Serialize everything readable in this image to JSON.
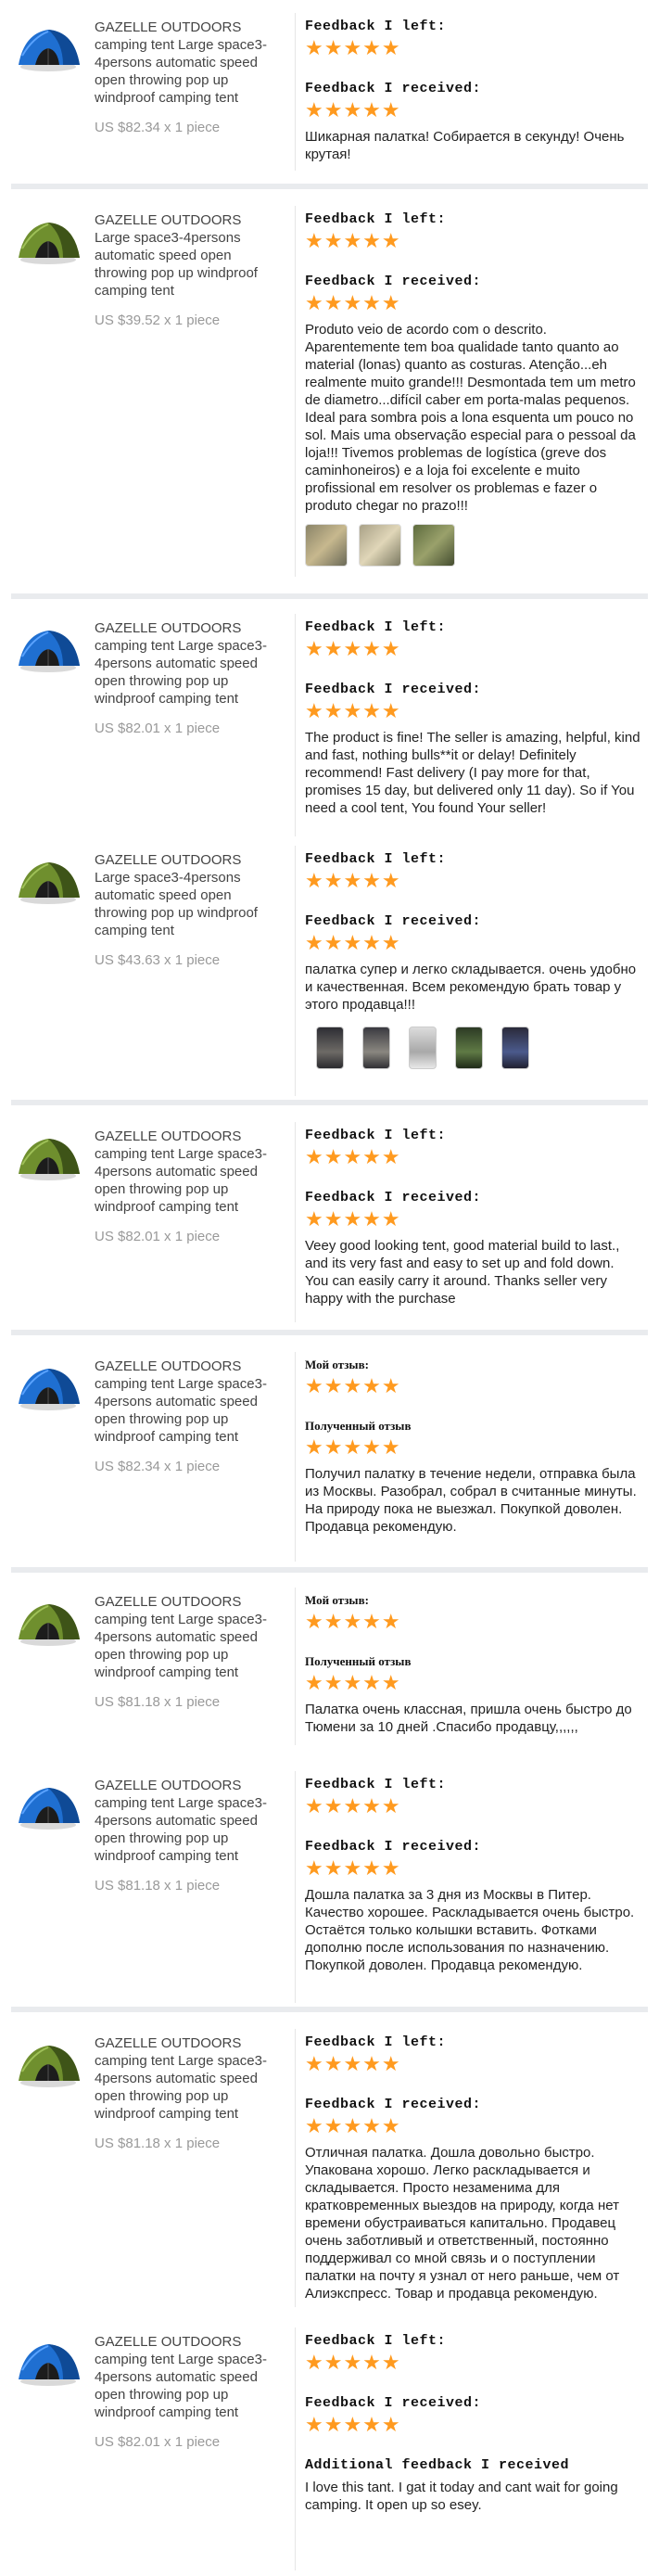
{
  "colors": {
    "star": "#ff9a1f",
    "divider": "#e9ebee",
    "price": "#999999"
  },
  "star_glyphs": "★★★★★",
  "reviews": [
    {
      "tent_color": "blue",
      "brand": "GAZELLE OUTDOORS",
      "name": "camping tent Large space3-4persons automatic speed open throwing pop up windproof camping tent",
      "price": "US $82.34 x 1 piece",
      "left_label": "Feedback I left:",
      "received_label": "Feedback I received:",
      "text": "Шикарная палатка! Собирается в секунду! Очень крутая!"
    },
    {
      "tent_color": "green",
      "brand": "GAZELLE OUTDOORS",
      "name": "Large space3-4persons automatic speed open throwing pop up windproof camping tent",
      "price": "US $39.52 x 1 piece",
      "left_label": "Feedback I left:",
      "received_label": "Feedback I received:",
      "text": "Produto veio de acordo com o descrito. Aparentemente tem boa qualidade tanto quanto ao material (lonas) quanto as costuras. Atenção...eh realmente muito grande!!! Desmontada tem um metro de diametro...difícil caber em porta-malas pequenos. Ideal para sombra pois a lona esquenta um pouco no sol. Mais uma observação especial para o pessoal da loja!!! Tivemos problemas de logística (greve dos caminhoneiros) e a loja foi excelente e muito profissional em resolver os problemas e fazer o produto chegar no prazo!!!",
      "photos": 3
    },
    {
      "tent_color": "blue",
      "brand": "GAZELLE OUTDOORS",
      "name": "camping tent Large space3-4persons automatic speed open throwing pop up windproof camping tent",
      "price": "US $82.01 x 1 piece",
      "left_label": "Feedback I left:",
      "received_label": "Feedback I received:",
      "text": "The product is fine! The seller is amazing, helpful, kind and fast, nothing bulls**it or delay! Definitely recommend! Fast delivery (I pay more for that, promises 15 day, but delivered only 11 day). So if You need a cool tent, You found Your seller!"
    },
    {
      "tent_color": "green",
      "brand": "GAZELLE OUTDOORS",
      "name": "Large space3-4persons automatic speed open throwing pop up windproof camping tent",
      "price": "US $43.63 x 1 piece",
      "left_label": "Feedback I left:",
      "received_label": "Feedback I received:",
      "text": "палатка супер и легко складывается. очень удобно и качественная. Всем рекомендую брать товар у этого продавца!!!",
      "photos": 5
    },
    {
      "tent_color": "green",
      "brand": "GAZELLE OUTDOORS",
      "name": "camping tent Large space3-4persons automatic speed open throwing pop up windproof camping tent",
      "price": "US $82.01 x 1 piece",
      "left_label": "Feedback I left:",
      "received_label": "Feedback I received:",
      "text": "Veey good looking tent, good material build to last., and its very fast and easy to set up and fold down. You can easily carry it around. Thanks seller very happy with the purchase"
    },
    {
      "tent_color": "blue",
      "brand": "GAZELLE OUTDOORS",
      "name": "camping tent Large space3-4persons automatic speed open throwing pop up windproof camping tent",
      "price": "US $82.34 x 1 piece",
      "left_label": "Мой отзыв:",
      "received_label": "Полученный отзыв",
      "ru_labels": true,
      "text": "Получил палатку в течение недели, отправка была из Москвы. Разобрал, собрал в считанные минуты. На природу пока не выезжал. Покупкой доволен. Продавца рекомендую."
    },
    {
      "tent_color": "green",
      "brand": "GAZELLE OUTDOORS",
      "name": "camping tent Large space3-4persons automatic speed open throwing pop up windproof camping tent",
      "price": "US $81.18 x 1 piece",
      "left_label": "Мой отзыв:",
      "received_label": "Полученный отзыв",
      "ru_labels": true,
      "text": "Палатка очень классная, пришла очень быстро до Тюмени за 10 дней .Спасибо продавцу,,,,,,"
    },
    {
      "tent_color": "blue",
      "brand": "GAZELLE OUTDOORS",
      "name": "camping tent Large space3-4persons automatic speed open throwing pop up windproof camping tent",
      "price": "US $81.18 x 1 piece",
      "left_label": "Feedback I left:",
      "received_label": "Feedback I received:",
      "text": "Дошла палатка за 3 дня из Москвы в Питер. Качество хорошее. Раскладывается очень быстро. Остаётся только колышки вставить. Фотками дополню после использования по назначению. Покупкой доволен. Продавца рекомендую."
    },
    {
      "tent_color": "green",
      "brand": "GAZELLE OUTDOORS",
      "name": "camping tent Large space3-4persons automatic speed open throwing pop up windproof camping tent",
      "price": "US $81.18 x 1 piece",
      "left_label": "Feedback I left:",
      "received_label": "Feedback I received:",
      "text": "Отличная палатка. Дошла довольно быстро. Упакована хорошо. Легко раскладывается и складывается. Просто незаменима для кратковременных выездов на природу, когда нет времени обустраиваться капитально. Продавец очень заботливый и ответственный, постоянно поддерживал со мной связь и о поступлении палатки на почту я узнал от него раньше, чем от Алиэкспресс. Товар и продавца рекомендую."
    },
    {
      "tent_color": "blue",
      "brand": "GAZELLE OUTDOORS",
      "name": "camping tent Large space3-4persons automatic speed open throwing pop up windproof camping tent",
      "price": "US $82.01 x 1 piece",
      "left_label": "Feedback I left:",
      "received_label": "Feedback I received:",
      "additional_label": "Additional feedback I received",
      "additional_text": "I love this tant. I gat it today and cant wait for going camping. It open up so esey."
    }
  ]
}
